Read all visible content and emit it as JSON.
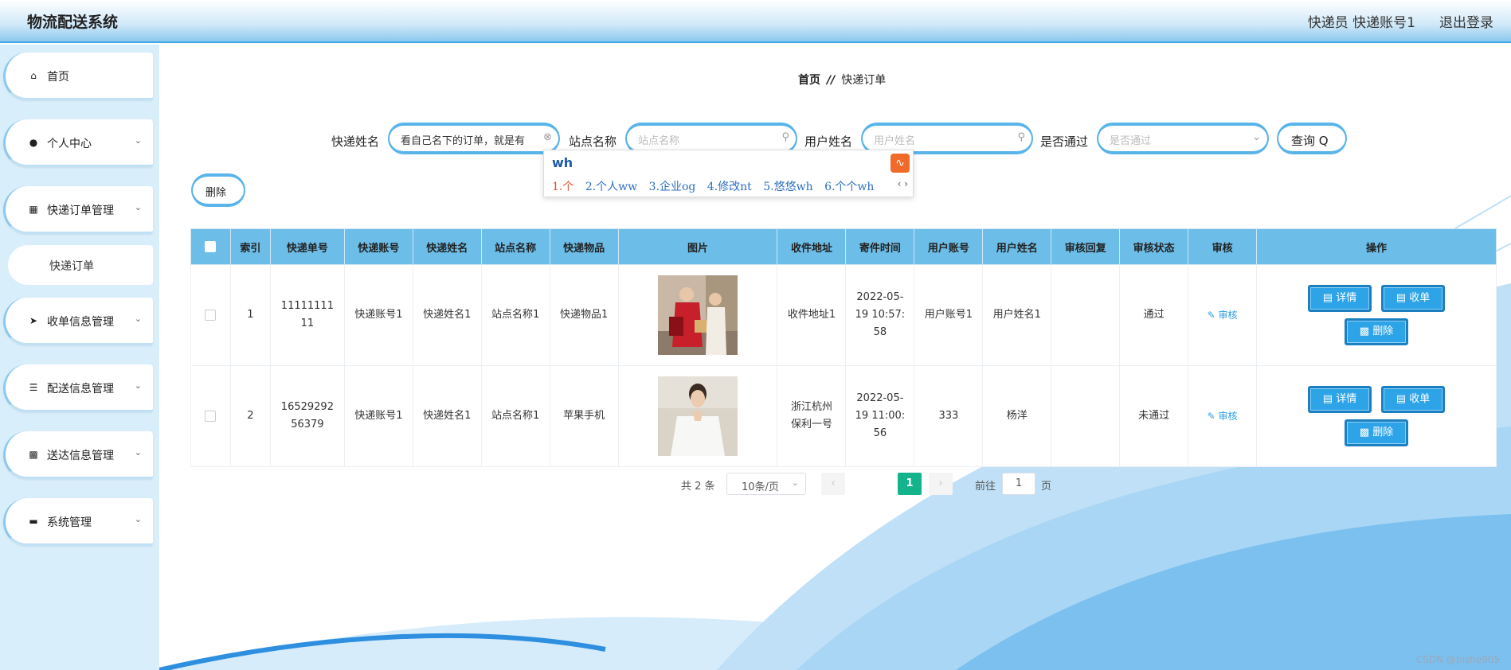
{
  "header": {
    "title": "物流配送系统",
    "user": "快递员 快递账号1",
    "logout": "退出登录"
  },
  "sidebar": {
    "items": [
      {
        "label": "首页",
        "icon": "home-icon"
      },
      {
        "label": "个人中心",
        "icon": "user-icon"
      },
      {
        "label": "快递订单管理",
        "icon": "grid-icon"
      },
      {
        "label": "快递订单",
        "icon": ""
      },
      {
        "label": "收单信息管理",
        "icon": "send-icon"
      },
      {
        "label": "配送信息管理",
        "icon": "list-icon"
      },
      {
        "label": "送达信息管理",
        "icon": "monitor-icon"
      },
      {
        "label": "系统管理",
        "icon": "chat-icon"
      }
    ]
  },
  "breadcrumb": {
    "home": "首页",
    "sep": "//",
    "current": "快递订单"
  },
  "filters": {
    "courier_name_label": "快递姓名",
    "courier_name_value": "看自己名下的订单，就是有",
    "station_label": "站点名称",
    "station_placeholder": "站点名称",
    "username_label": "用户姓名",
    "username_placeholder": "用户姓名",
    "passed_label": "是否通过",
    "passed_placeholder": "是否通过",
    "query_label": "查询 Q"
  },
  "ime": {
    "typed": "wh",
    "candidates": [
      "1.个",
      "2.个人ww",
      "3.企业og",
      "4.修改nt",
      "5.悠悠wh",
      "6.个个wh"
    ]
  },
  "toolbar": {
    "delete_label": "删除"
  },
  "table": {
    "headers": [
      "索引",
      "快递单号",
      "快递账号",
      "快递姓名",
      "站点名称",
      "快递物品",
      "图片",
      "收件地址",
      "寄件时间",
      "用户账号",
      "用户姓名",
      "审核回复",
      "审核状态",
      "审核",
      "操作"
    ],
    "rows": [
      {
        "index": "1",
        "order_no": "1111111111",
        "account": "快递账号1",
        "name": "快递姓名1",
        "station": "站点名称1",
        "item": "快递物品1",
        "address": "收件地址1",
        "time": "2022-05-19 10:57:58",
        "user_account": "用户账号1",
        "user_name": "用户姓名1",
        "reply": "",
        "status": "通过",
        "audit": "审核"
      },
      {
        "index": "2",
        "order_no": "1652929256379",
        "account": "快递账号1",
        "name": "快递姓名1",
        "station": "站点名称1",
        "item": "苹果手机",
        "address": "浙江杭州保利一号",
        "time": "2022-05-19 11:00:56",
        "user_account": "333",
        "user_name": "杨洋",
        "reply": "",
        "status": "未通过",
        "audit": "审核"
      }
    ],
    "actions": {
      "detail": "详情",
      "receive": "收单",
      "delete": "删除"
    }
  },
  "pagination": {
    "total": "共 2 条",
    "page_size": "10条/页",
    "current_page": "1",
    "goto_label": "前往",
    "goto_value": "1",
    "page_suffix": "页"
  },
  "watermark": "CSDN @bishe905",
  "colors": {
    "accent": "#2ea4e8",
    "header_row": "#6cbde8",
    "active_page": "#13b38b",
    "sidebar_bg": "#d9eefb"
  }
}
